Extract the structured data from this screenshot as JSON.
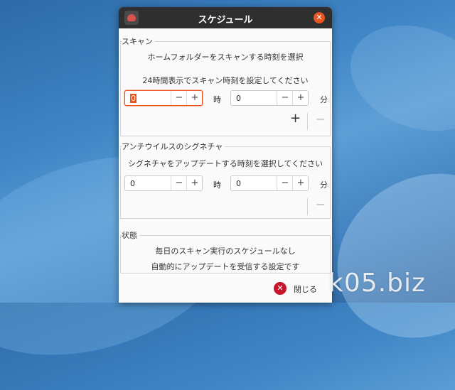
{
  "window": {
    "title": "スケジュール"
  },
  "scan": {
    "legend": "スキャン",
    "line1": "ホームフォルダーをスキャンする時刻を選択",
    "line2": "24時間表示でスキャン時刻を設定してください",
    "hour_value": "0",
    "hour_unit": "時",
    "minute_value": "0",
    "minute_unit": "分"
  },
  "signature": {
    "legend": "アンチウイルスのシグネチャ",
    "line1": "シグネチャをアップデートする時刻を選択してください",
    "hour_value": "0",
    "hour_unit": "時",
    "minute_value": "0",
    "minute_unit": "分"
  },
  "status": {
    "legend": "状態",
    "line1": "毎日のスキャン実行のスケジュールなし",
    "line2": "自動的にアップデートを受信する設定です"
  },
  "buttons": {
    "close_label": "閉じる"
  },
  "glyphs": {
    "minus": "−",
    "plus": "+",
    "close_x": "✕"
  },
  "watermark": "k05.biz",
  "colors": {
    "accent": "#e95420",
    "titlebar": "#2f2f2f",
    "close_button": "#c7162b"
  }
}
